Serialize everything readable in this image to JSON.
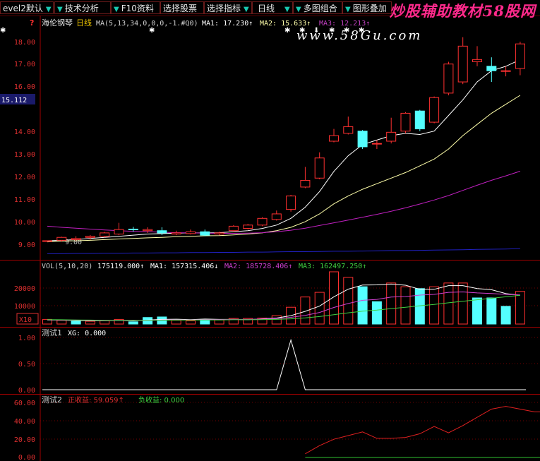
{
  "toolbar": {
    "level": "evel2默认",
    "items": [
      "技术分析",
      "F10资料",
      "选择股票",
      "选择指标",
      "日线",
      "多图组合",
      "图形叠加"
    ]
  },
  "watermark": {
    "title": "炒股辅助教材58股网",
    "url": "www.58Gu.com"
  },
  "price_panel": {
    "stock_name": "海伦钢琴",
    "period": "日线",
    "ma_params": "MA(5,13,34,0,0,0,-1.#Q0)",
    "ma1": "MA1: 17.230↑",
    "ma2": "MA2: 15.633↑",
    "ma3": "MA3: 12.213↑",
    "help": "?",
    "current_price": "15.112",
    "low_marker": "9.00",
    "y_labels": [
      "18.00",
      "17.00",
      "16.00",
      "14.00",
      "13.00",
      "12.00",
      "11.00",
      "10.00",
      "9.00"
    ]
  },
  "vol_panel": {
    "title": "VOL(5,10,20)",
    "vol": "175119.000↑",
    "ma1": "MA1: 157315.406↓",
    "ma2": "MA2: 185728.406↑",
    "ma3": "MA3: 162497.250↑",
    "unit": "X10",
    "y_labels": [
      "20000",
      "10000"
    ]
  },
  "test1_panel": {
    "title": "测试1",
    "label": "XG: 0.000",
    "y_labels": [
      "1.00",
      "0.50",
      "0.00"
    ]
  },
  "test2_panel": {
    "title": "测试2",
    "pos": "正收益: 59.059↑",
    "neg": "负收益: 0.000",
    "y_labels": [
      "60.00",
      "40.00",
      "20.00",
      "0.00"
    ]
  },
  "chart_data": [
    {
      "type": "candlestick",
      "title": "海伦钢琴 日线",
      "ylim": [
        8.5,
        18.6
      ],
      "candles": [
        [
          9.1,
          9.1,
          9.1,
          9.05
        ],
        [
          9.12,
          9.25,
          9.28,
          9.05
        ],
        [
          9.15,
          9.2,
          9.3,
          9.1
        ],
        [
          9.25,
          9.3,
          9.35,
          9.15
        ],
        [
          9.3,
          9.45,
          9.5,
          9.25
        ],
        [
          9.4,
          9.6,
          9.9,
          9.35
        ],
        [
          9.62,
          9.6,
          9.72,
          9.5
        ],
        [
          9.55,
          9.6,
          9.7,
          9.45
        ],
        [
          9.55,
          9.45,
          9.7,
          9.35
        ],
        [
          9.4,
          9.45,
          9.55,
          9.35
        ],
        [
          9.42,
          9.5,
          9.6,
          9.38
        ],
        [
          9.5,
          9.35,
          9.6,
          9.3
        ],
        [
          9.4,
          9.45,
          9.5,
          9.35
        ],
        [
          9.55,
          9.75,
          9.8,
          9.5
        ],
        [
          9.65,
          9.8,
          9.85,
          9.6
        ],
        [
          9.8,
          10.1,
          10.15,
          9.75
        ],
        [
          10.05,
          10.3,
          10.45,
          10.0
        ],
        [
          10.5,
          11.1,
          11.15,
          10.4
        ],
        [
          11.5,
          11.8,
          12.4,
          11.45
        ],
        [
          11.9,
          12.8,
          13.05,
          11.85
        ],
        [
          13.55,
          13.8,
          14.1,
          13.5
        ],
        [
          13.9,
          14.2,
          14.65,
          13.85
        ],
        [
          14.0,
          13.3,
          14.05,
          13.2
        ],
        [
          13.45,
          13.45,
          13.6,
          13.2
        ],
        [
          13.55,
          13.95,
          14.6,
          13.45
        ],
        [
          14.0,
          14.8,
          14.85,
          13.9
        ],
        [
          14.9,
          14.1,
          14.95,
          14.0
        ],
        [
          14.4,
          15.5,
          15.55,
          14.35
        ],
        [
          15.7,
          17.0,
          17.1,
          15.6
        ],
        [
          16.2,
          17.8,
          18.2,
          16.1
        ],
        [
          17.1,
          17.2,
          17.8,
          16.9
        ],
        [
          16.9,
          16.7,
          17.3,
          16.2
        ],
        [
          16.7,
          16.7,
          16.9,
          16.45
        ],
        [
          16.8,
          17.9,
          18.0,
          16.5
        ]
      ],
      "ma_lines": {
        "ma1": [
          9.1,
          9.12,
          9.15,
          9.2,
          9.25,
          9.3,
          9.35,
          9.4,
          9.42,
          9.44,
          9.45,
          9.45,
          9.46,
          9.5,
          9.55,
          9.65,
          9.8,
          10.1,
          10.6,
          11.3,
          12.2,
          12.9,
          13.4,
          13.6,
          13.8,
          13.9,
          13.85,
          14.0,
          14.7,
          15.4,
          16.2,
          16.7,
          16.9,
          17.2
        ],
        "ma2": [
          9.05,
          9.08,
          9.1,
          9.12,
          9.15,
          9.18,
          9.2,
          9.23,
          9.25,
          9.28,
          9.3,
          9.32,
          9.33,
          9.36,
          9.4,
          9.45,
          9.55,
          9.7,
          9.95,
          10.3,
          10.75,
          11.1,
          11.4,
          11.65,
          11.9,
          12.15,
          12.45,
          12.75,
          13.2,
          13.8,
          14.3,
          14.8,
          15.2,
          15.6
        ],
        "ma3": [
          9.75,
          9.7,
          9.66,
          9.62,
          9.58,
          9.55,
          9.52,
          9.5,
          9.48,
          9.46,
          9.45,
          9.44,
          9.43,
          9.43,
          9.44,
          9.46,
          9.5,
          9.57,
          9.66,
          9.78,
          9.9,
          10.02,
          10.15,
          10.28,
          10.42,
          10.57,
          10.74,
          10.92,
          11.12,
          11.35,
          11.58,
          11.8,
          12.0,
          12.21
        ],
        "long": [
          8.52,
          8.52,
          8.53,
          8.53,
          8.54,
          8.54,
          8.55,
          8.55,
          8.56,
          8.56,
          8.57,
          8.57,
          8.58,
          8.58,
          8.59,
          8.59,
          8.6,
          8.61,
          8.61,
          8.62,
          8.63,
          8.63,
          8.64,
          8.65,
          8.66,
          8.66,
          8.67,
          8.68,
          8.69,
          8.7,
          8.71,
          8.72,
          8.73,
          8.75
        ]
      }
    },
    {
      "type": "bar",
      "title": "VOL(5,10,20)",
      "ylim": [
        0,
        28000
      ],
      "values": [
        2500,
        2000,
        1500,
        1500,
        1800,
        2500,
        1200,
        3500,
        3800,
        2000,
        1700,
        2500,
        2200,
        3000,
        3000,
        3200,
        4500,
        9000,
        14500,
        17000,
        28000,
        25000,
        20000,
        12000,
        22000,
        20000,
        19000,
        20000,
        22000,
        22000,
        14000,
        14000,
        9500,
        17500
      ],
      "colors": [
        "r",
        "r",
        "g",
        "r",
        "r",
        "r",
        "g",
        "g",
        "g",
        "r",
        "r",
        "g",
        "r",
        "r",
        "r",
        "r",
        "r",
        "r",
        "r",
        "r",
        "r",
        "r",
        "g",
        "g",
        "r",
        "r",
        "g",
        "r",
        "r",
        "r",
        "g",
        "g",
        "g",
        "r"
      ],
      "ma5": [
        2200,
        2100,
        1900,
        1800,
        1800,
        1900,
        1700,
        2100,
        2500,
        2600,
        2400,
        2700,
        2500,
        2500,
        2300,
        2800,
        3200,
        4500,
        6800,
        9600,
        14600,
        18700,
        20900,
        21000,
        21400,
        20800,
        18600,
        18600,
        20600,
        20600,
        19000,
        18400,
        16300,
        15400
      ],
      "ma10": [
        2300,
        2200,
        2100,
        2000,
        1900,
        1900,
        1900,
        2000,
        2100,
        2200,
        2200,
        2300,
        2400,
        2500,
        2500,
        2700,
        2900,
        3600,
        4600,
        6200,
        8900,
        11000,
        12700,
        13200,
        14500,
        14700,
        15500,
        15900,
        17000,
        17200,
        16700,
        16400,
        15900,
        15600
      ],
      "ma20": [
        2400,
        2300,
        2200,
        2100,
        2000,
        2000,
        2000,
        2000,
        2000,
        2100,
        2100,
        2200,
        2200,
        2300,
        2300,
        2400,
        2500,
        2800,
        3300,
        4000,
        5000,
        6000,
        6900,
        7500,
        8300,
        9000,
        9800,
        10500,
        11400,
        12200,
        13000,
        13800,
        14600,
        15400
      ]
    },
    {
      "type": "line",
      "title": "测试1",
      "series": [
        {
          "name": "XG",
          "values": [
            0,
            0,
            0,
            0,
            0,
            0,
            0,
            0,
            0,
            0,
            0,
            0,
            0,
            0,
            0,
            0,
            0,
            0,
            0,
            0,
            0,
            0,
            0,
            0,
            0,
            0,
            0,
            0,
            0,
            0,
            0,
            0,
            0,
            0
          ]
        }
      ],
      "spike": {
        "x": 17,
        "y": 1.0
      },
      "ylim": [
        0,
        1.05
      ]
    },
    {
      "type": "line",
      "title": "测试2",
      "series": [
        {
          "name": "正收益",
          "values": [
            4,
            13,
            20,
            24,
            28,
            21,
            21,
            22,
            26,
            34,
            27,
            35,
            44,
            53,
            56,
            53,
            50,
            50,
            59
          ]
        },
        {
          "name": "负收益",
          "values": [
            0,
            0,
            0,
            0,
            0,
            0,
            0,
            0,
            0,
            0,
            0,
            0,
            0,
            0,
            0,
            0,
            0,
            0,
            0
          ]
        }
      ],
      "ylim": [
        0,
        65
      ]
    }
  ]
}
